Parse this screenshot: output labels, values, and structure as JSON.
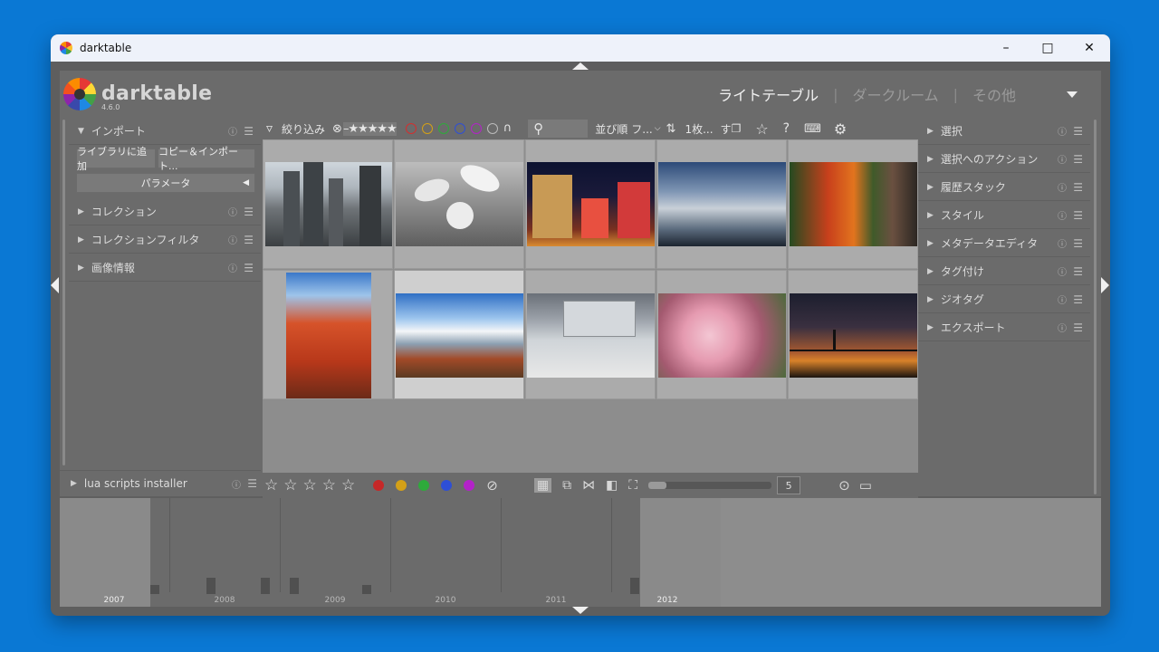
{
  "window": {
    "title": "darktable"
  },
  "header": {
    "logo_text": "darktable",
    "version": "4.6.0",
    "views": [
      "ライトテーブル",
      "ダークルーム",
      "その他"
    ],
    "separator": "|"
  },
  "left_panel": {
    "import": {
      "label": "インポート",
      "add_to_library": "ライブラリに追加",
      "copy_import": "コピー＆インポート...",
      "parameters": "パラメータ"
    },
    "modules": [
      "コレクション",
      "コレクションフィルタ",
      "画像情報"
    ],
    "lua": "lua scripts installer"
  },
  "right_panel": {
    "modules": [
      "選択",
      "選択へのアクション",
      "履歴スタック",
      "スタイル",
      "メタデータエディタ",
      "タグ付け",
      "ジオタグ",
      "エクスポート"
    ]
  },
  "toolbar": {
    "filter_label": "絞り込み",
    "sort_label": "並び順",
    "sort_value": "フ...",
    "count_label": "1枚...",
    "all_label": "す",
    "help": "?"
  },
  "bottom": {
    "zoom_value": "5"
  },
  "timeline": {
    "years": [
      "2007",
      "2008",
      "2009",
      "2010",
      "2011",
      "2012"
    ]
  },
  "colors": {
    "red": "#c62828",
    "yellow": "#d4a017",
    "green": "#2eaa3b",
    "blue": "#2e4fd6",
    "purple": "#b322c9",
    "accent": "#0a78d4"
  },
  "icons": [
    "filter-icon",
    "search-icon",
    "sort-icon",
    "star-icon",
    "help-icon",
    "keyboard-icon",
    "gear-icon",
    "grid-icon",
    "culling-icon",
    "compare-icon",
    "fullscreen-icon",
    "focus-peaking-icon",
    "display-icon",
    "reject-icon"
  ]
}
